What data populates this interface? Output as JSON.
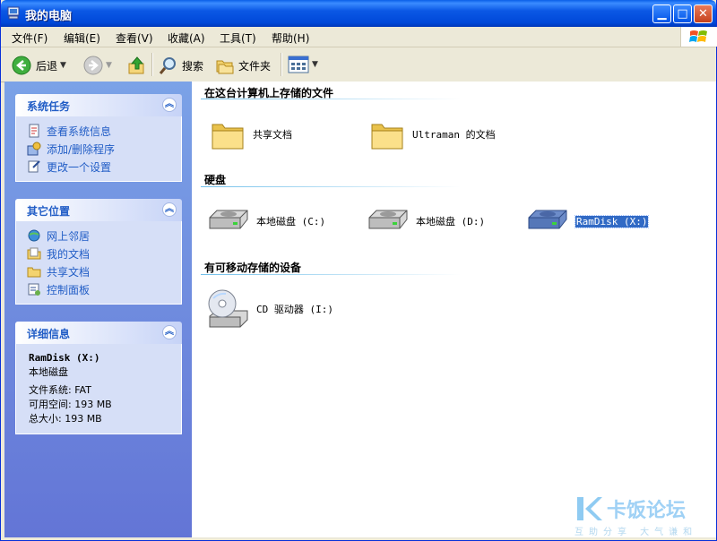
{
  "window": {
    "title": "我的电脑"
  },
  "menu": [
    "文件(F)",
    "编辑(E)",
    "查看(V)",
    "收藏(A)",
    "工具(T)",
    "帮助(H)"
  ],
  "toolbar": {
    "back": "后退",
    "search": "搜索",
    "folders": "文件夹"
  },
  "left": {
    "system_tasks": {
      "title": "系统任务",
      "items": [
        "查看系统信息",
        "添加/删除程序",
        "更改一个设置"
      ]
    },
    "other_places": {
      "title": "其它位置",
      "items": [
        "网上邻居",
        "我的文档",
        "共享文档",
        "控制面板"
      ]
    },
    "details": {
      "title": "详细信息",
      "name": "RamDisk (X:)",
      "type": "本地磁盘",
      "fs": "文件系统: FAT",
      "free": "可用空间: 193 MB",
      "total": "总大小: 193 MB"
    }
  },
  "groups": {
    "files": {
      "title": "在这台计算机上存储的文件",
      "items": [
        "共享文档",
        "Ultraman 的文档"
      ]
    },
    "disks": {
      "title": "硬盘",
      "items": [
        "本地磁盘 (C:)",
        "本地磁盘 (D:)",
        "RamDisk (X:)"
      ]
    },
    "removable": {
      "title": "有可移动存储的设备",
      "items": [
        "CD 驱动器 (I:)"
      ]
    }
  },
  "watermark": {
    "main": "卡饭论坛",
    "sub": "互助分享 大气谦和"
  },
  "colors": {
    "title_bar": "#0054e3",
    "task_link": "#215dc6",
    "selection": "#316ac5"
  }
}
